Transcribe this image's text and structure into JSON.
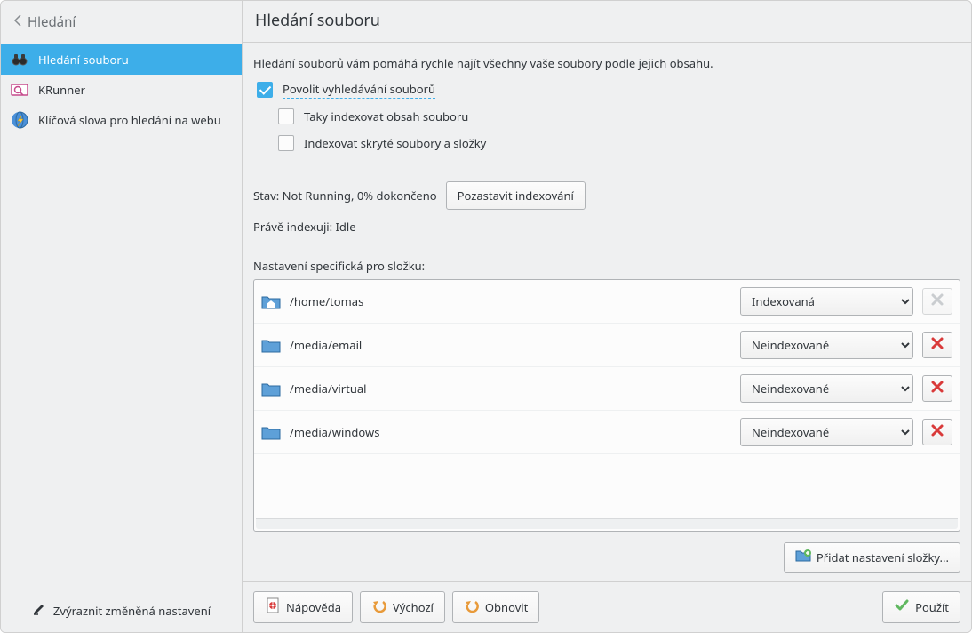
{
  "sidebar": {
    "back_label": "Hledání",
    "items": [
      {
        "label": "Hledání souboru"
      },
      {
        "label": "KRunner"
      },
      {
        "label": "Klíčová slova pro hledání na webu"
      }
    ],
    "footer": "Zvýraznit změněná nastavení"
  },
  "header": {
    "title": "Hledání souboru"
  },
  "main": {
    "description": "Hledání souborů vám pomáhá rychle najít všechny vaše soubory podle jejich obsahu.",
    "enable_search_label": "Povolit vyhledávání souborů",
    "enable_search_checked": true,
    "index_content_label": "Taky indexovat obsah souboru",
    "index_content_checked": false,
    "index_hidden_label": "Indexovat skryté soubory a složky",
    "index_hidden_checked": false,
    "status_label": "Stav: Not Running, 0% dokončeno",
    "pause_button": "Pozastavit indexování",
    "currently_indexing": "Právě indexuji: Idle",
    "folder_settings_label": "Nastavení specifická pro složku:",
    "folders": [
      {
        "path": "/home/tomas",
        "mode": "Indexovaná",
        "removable": false,
        "home": true
      },
      {
        "path": "/media/email",
        "mode": "Neindexované",
        "removable": true,
        "home": false
      },
      {
        "path": "/media/virtual",
        "mode": "Neindexované",
        "removable": true,
        "home": false
      },
      {
        "path": "/media/windows",
        "mode": "Neindexované",
        "removable": true,
        "home": false
      }
    ],
    "mode_options": [
      "Indexovaná",
      "Neindexované"
    ],
    "add_folder_button": "Přidat nastavení složky..."
  },
  "footer": {
    "help": "Nápověda",
    "defaults": "Výchozí",
    "reset": "Obnovit",
    "apply": "Použít"
  }
}
